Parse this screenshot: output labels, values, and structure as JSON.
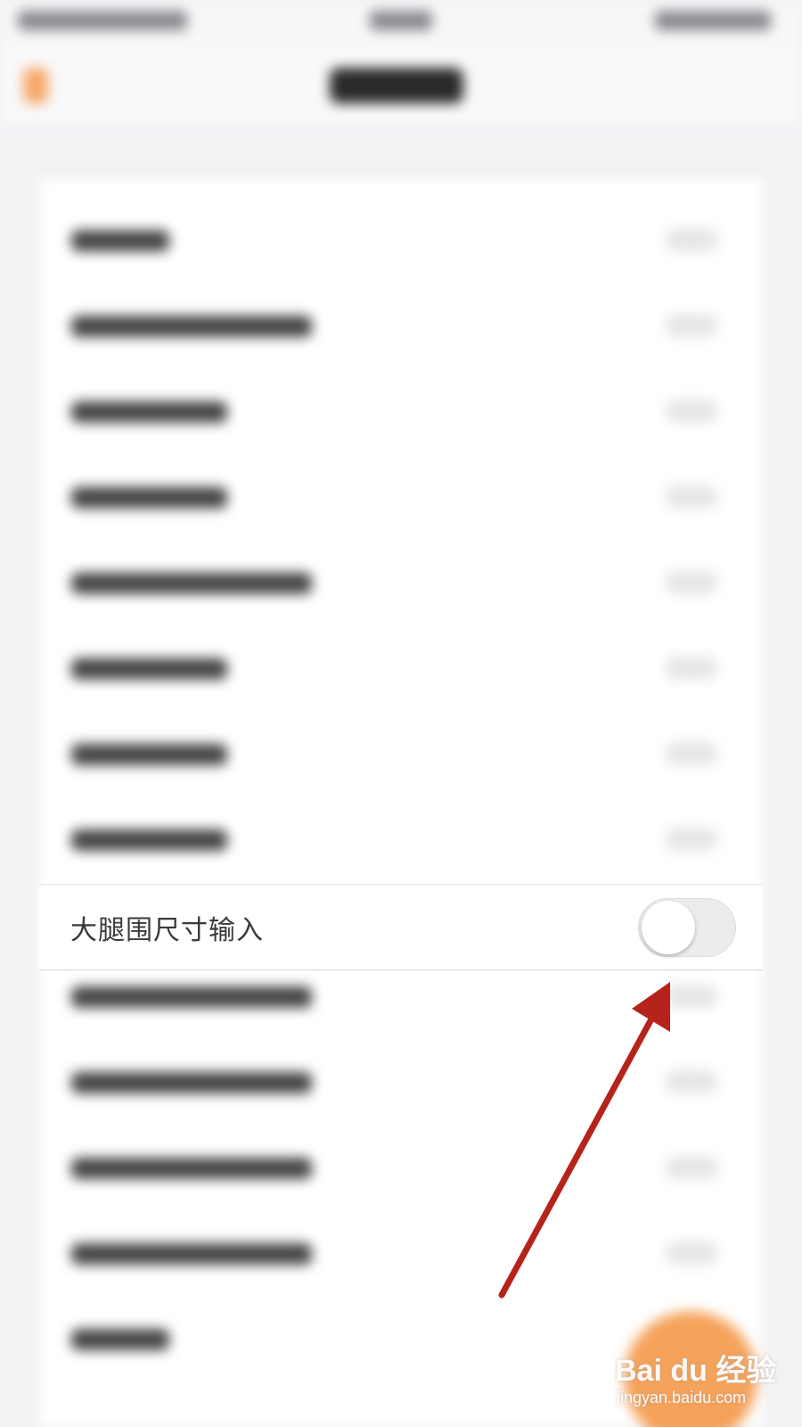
{
  "highlighted_row": {
    "label": "大腿围尺寸输入",
    "toggle_state": "off"
  },
  "blurred_rows": [
    {
      "label_length": "short"
    },
    {
      "label_length": "long"
    },
    {
      "label_length": "medium"
    },
    {
      "label_length": "medium"
    },
    {
      "label_length": "long"
    },
    {
      "label_length": "medium"
    },
    {
      "label_length": "medium"
    },
    {
      "label_length": "medium"
    },
    {
      "label_length": "long"
    },
    {
      "label_length": "long"
    },
    {
      "label_length": "long"
    },
    {
      "label_length": "long"
    },
    {
      "label_length": "short"
    }
  ],
  "annotation": {
    "type": "arrow",
    "color": "#b5231a",
    "points_to": "toggle-switch"
  },
  "watermark": {
    "brand": "Bai du 经验",
    "url": "jingyan.baidu.com"
  },
  "colors": {
    "accent_orange": "#f5a25a",
    "toggle_off_track": "#ececec",
    "text_primary": "#3a3a3a"
  }
}
